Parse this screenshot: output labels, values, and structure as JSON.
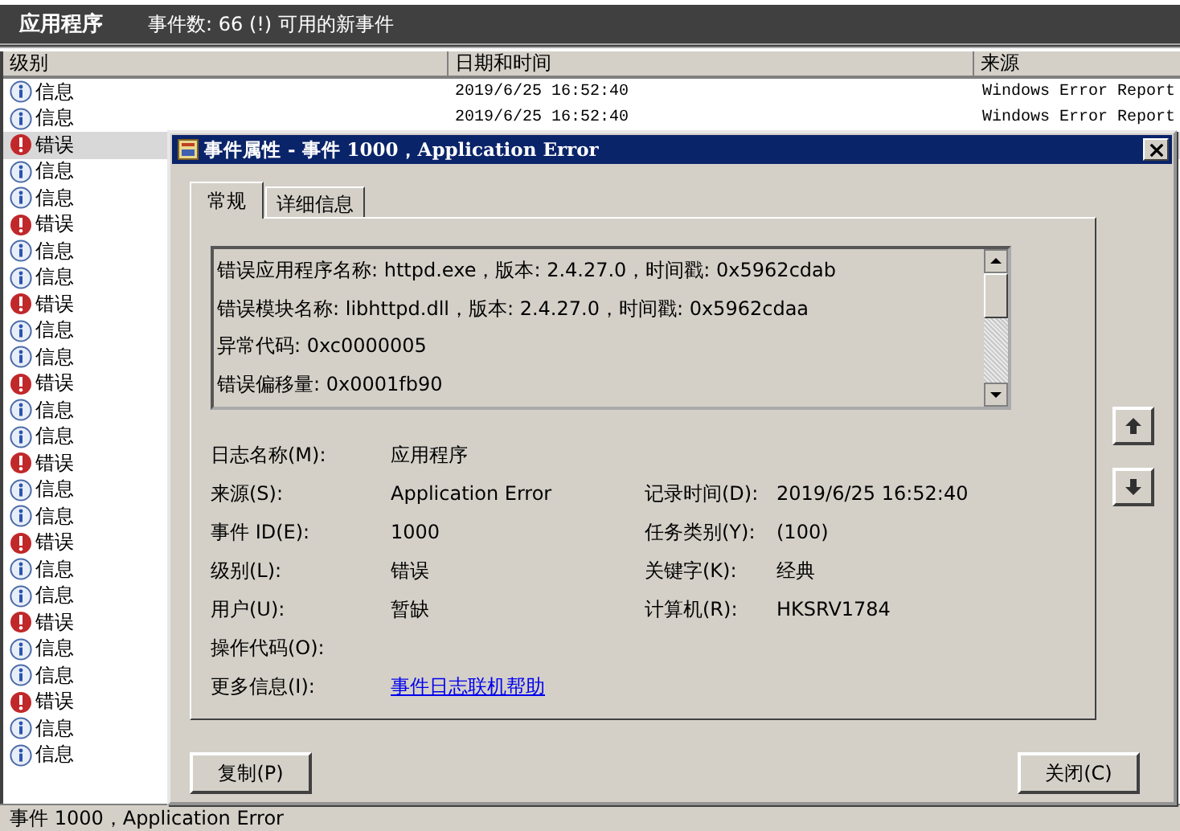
{
  "app_bar": {
    "title": "应用程序",
    "summary": "事件数: 66 (!) 可用的新事件"
  },
  "table": {
    "columns": [
      "级别",
      "日期和时间",
      "来源"
    ],
    "rows": [
      {
        "kind": "info",
        "level": "信息",
        "date": "2019/6/25 16:52:40",
        "source": "Windows Error Report",
        "selected": false
      },
      {
        "kind": "info",
        "level": "信息",
        "date": "2019/6/25 16:52:40",
        "source": "Windows Error Report",
        "selected": false
      },
      {
        "kind": "error",
        "level": "错误",
        "selected": true
      },
      {
        "kind": "info",
        "level": "信息",
        "selected": false
      },
      {
        "kind": "info",
        "level": "信息",
        "selected": false
      },
      {
        "kind": "error",
        "level": "错误",
        "selected": false
      },
      {
        "kind": "info",
        "level": "信息",
        "selected": false
      },
      {
        "kind": "info",
        "level": "信息",
        "selected": false
      },
      {
        "kind": "error",
        "level": "错误",
        "selected": false
      },
      {
        "kind": "info",
        "level": "信息",
        "selected": false
      },
      {
        "kind": "info",
        "level": "信息",
        "selected": false
      },
      {
        "kind": "error",
        "level": "错误",
        "selected": false
      },
      {
        "kind": "info",
        "level": "信息",
        "selected": false
      },
      {
        "kind": "info",
        "level": "信息",
        "selected": false
      },
      {
        "kind": "error",
        "level": "错误",
        "selected": false
      },
      {
        "kind": "info",
        "level": "信息",
        "selected": false
      },
      {
        "kind": "info",
        "level": "信息",
        "selected": false
      },
      {
        "kind": "error",
        "level": "错误",
        "selected": false
      },
      {
        "kind": "info",
        "level": "信息",
        "selected": false
      },
      {
        "kind": "info",
        "level": "信息",
        "selected": false
      },
      {
        "kind": "error",
        "level": "错误",
        "selected": false
      },
      {
        "kind": "info",
        "level": "信息",
        "selected": false
      },
      {
        "kind": "info",
        "level": "信息",
        "selected": false
      },
      {
        "kind": "error",
        "level": "错误",
        "selected": false
      },
      {
        "kind": "info",
        "level": "信息",
        "selected": false
      },
      {
        "kind": "info",
        "level": "信息",
        "selected": false
      }
    ]
  },
  "status_bar": "事件 1000，Application Error",
  "dialog": {
    "title": "事件属性 - 事件 1000，Application Error",
    "tabs": [
      {
        "label": "常规",
        "selected": true
      },
      {
        "label": "详细信息",
        "selected": false
      }
    ],
    "description": [
      "错误应用程序名称: httpd.exe，版本: 2.4.27.0，时间戳: 0x5962cdab",
      "错误模块名称: libhttpd.dll，版本: 2.4.27.0，时间戳: 0x5962cdaa",
      "异常代码: 0xc0000005",
      "错误偏移量: 0x0001fb90"
    ],
    "fields": [
      {
        "kind": "text",
        "label": "日志名称(M):",
        "value": "应用程序"
      },
      {
        "kind": "text",
        "label": "来源(S):",
        "value": "Application Error",
        "extra_label": "记录时间(D):",
        "extra_value": "2019/6/25 16:52:40"
      },
      {
        "kind": "text",
        "label": "事件 ID(E):",
        "value": "1000",
        "extra_label": "任务类别(Y):",
        "extra_value": "(100)"
      },
      {
        "kind": "text",
        "label": "级别(L):",
        "value": "错误",
        "extra_label": "关键字(K):",
        "extra_value": "经典"
      },
      {
        "kind": "text",
        "label": "用户(U):",
        "value": "暂缺",
        "extra_label": "计算机(R):",
        "extra_value": "HKSRV1784"
      },
      {
        "kind": "text",
        "label": "操作代码(O):"
      },
      {
        "kind": "link",
        "label": "更多信息(I):",
        "value": "事件日志联机帮助"
      }
    ],
    "buttons": [
      "复制(P)",
      "关闭(C)"
    ]
  }
}
